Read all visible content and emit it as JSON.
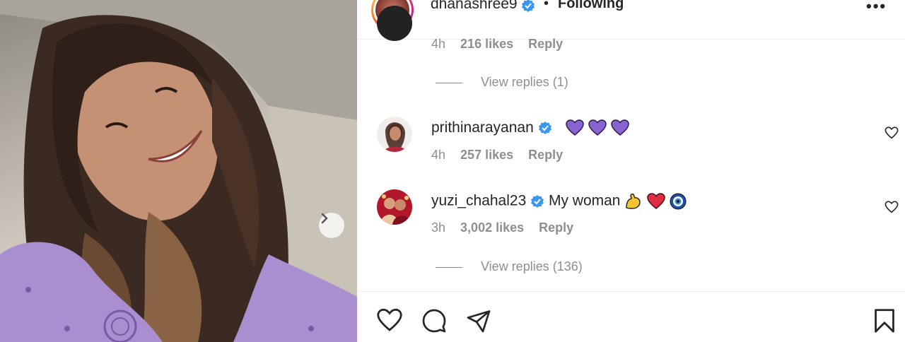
{
  "post": {
    "author": "dhanashree9",
    "follow_state": "Following",
    "separator": "•",
    "more_label": "•••"
  },
  "comments": [
    {
      "time": "4h",
      "likes": "216 likes",
      "reply": "Reply",
      "view_replies": "View replies (1)"
    },
    {
      "username": "prithinarayanan",
      "verified": true,
      "text": "",
      "emoji": [
        "purple-heart",
        "purple-heart",
        "purple-heart"
      ],
      "time": "4h",
      "likes": "257 likes",
      "reply": "Reply"
    },
    {
      "username": "yuzi_chahal23",
      "verified": true,
      "text": "My woman",
      "emoji": [
        "flexed-biceps",
        "red-heart",
        "nazar-amulet"
      ],
      "time": "3h",
      "likes": "3,002 likes",
      "reply": "Reply",
      "view_replies": "View replies (136)"
    }
  ],
  "actions": {
    "like_icon": "heart-icon",
    "comment_icon": "comment-icon",
    "share_icon": "send-icon",
    "save_icon": "bookmark-icon"
  },
  "colors": {
    "text": "#262626",
    "muted": "#8e8e8e",
    "verified": "#3897f0",
    "purple_heart": "#8a63d2",
    "red_heart": "#dd2e44"
  }
}
